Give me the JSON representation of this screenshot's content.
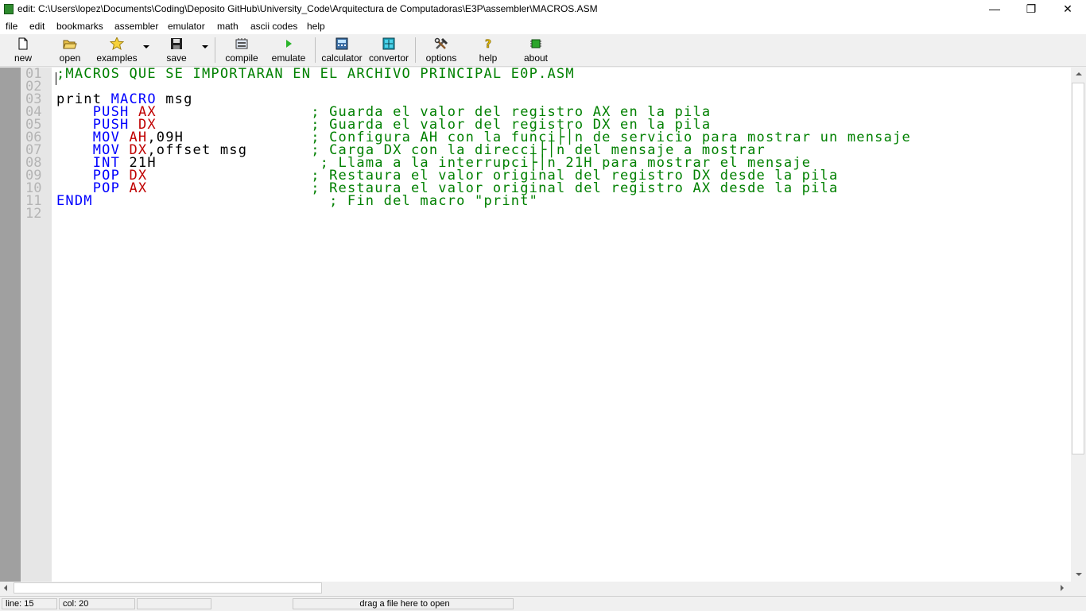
{
  "window": {
    "title": "edit: C:\\Users\\lopez\\Documents\\Coding\\Deposito GitHub\\University_Code\\Arquitectura de Computadoras\\E3P\\assembler\\MACROS.ASM",
    "minimize": "—",
    "restore": "❐",
    "close": "✕"
  },
  "menu": [
    "file",
    "edit",
    "bookmarks",
    "assembler",
    "emulator",
    "math",
    "ascii codes",
    "help"
  ],
  "toolbar": {
    "new": "new",
    "open": "open",
    "examples": "examples",
    "save": "save",
    "compile": "compile",
    "emulate": "emulate",
    "calculator": "calculator",
    "convertor": "convertor",
    "options": "options",
    "help": "help",
    "about": "about"
  },
  "line_numbers": [
    "01",
    "02",
    "03",
    "04",
    "05",
    "06",
    "07",
    "08",
    "09",
    "10",
    "11",
    "12"
  ],
  "code_lines": [
    [
      {
        "t": ";MACROS QUE SE IMPORTARAN EN EL ARCHIVO PRINCIPAL E0P.ASM",
        "c": "cmt"
      }
    ],
    [],
    [
      {
        "t": "print ",
        "c": "plain"
      },
      {
        "t": "MACRO",
        "c": "kw"
      },
      {
        "t": " msg",
        "c": "plain"
      }
    ],
    [
      {
        "t": "    ",
        "c": "plain"
      },
      {
        "t": "PUSH",
        "c": "kw"
      },
      {
        "t": " ",
        "c": "plain"
      },
      {
        "t": "AX",
        "c": "reg"
      },
      {
        "t": "                 ",
        "c": "plain"
      },
      {
        "t": "; Guarda el valor del registro AX en la pila",
        "c": "cmt"
      }
    ],
    [
      {
        "t": "    ",
        "c": "plain"
      },
      {
        "t": "PUSH",
        "c": "kw"
      },
      {
        "t": " ",
        "c": "plain"
      },
      {
        "t": "DX",
        "c": "reg"
      },
      {
        "t": "                 ",
        "c": "plain"
      },
      {
        "t": "; Guarda el valor del registro DX en la pila",
        "c": "cmt"
      }
    ],
    [
      {
        "t": "    ",
        "c": "plain"
      },
      {
        "t": "MOV",
        "c": "kw"
      },
      {
        "t": " ",
        "c": "plain"
      },
      {
        "t": "AH",
        "c": "reg"
      },
      {
        "t": ",09H",
        "c": "plain"
      },
      {
        "t": "              ",
        "c": "plain"
      },
      {
        "t": "; Configura AH con la funci├│n de servicio para mostrar un mensaje",
        "c": "cmt"
      }
    ],
    [
      {
        "t": "    ",
        "c": "plain"
      },
      {
        "t": "MOV",
        "c": "kw"
      },
      {
        "t": " ",
        "c": "plain"
      },
      {
        "t": "DX",
        "c": "reg"
      },
      {
        "t": ",offset msg",
        "c": "plain"
      },
      {
        "t": "       ",
        "c": "plain"
      },
      {
        "t": "; Carga DX con la direcci├│n del mensaje a mostrar",
        "c": "cmt"
      }
    ],
    [
      {
        "t": "    ",
        "c": "plain"
      },
      {
        "t": "INT",
        "c": "kw"
      },
      {
        "t": " 21H",
        "c": "plain"
      },
      {
        "t": "                  ",
        "c": "plain"
      },
      {
        "t": "; Llama a la interrupci├│n 21H para mostrar el mensaje",
        "c": "cmt"
      }
    ],
    [
      {
        "t": "    ",
        "c": "plain"
      },
      {
        "t": "POP",
        "c": "kw"
      },
      {
        "t": " ",
        "c": "plain"
      },
      {
        "t": "DX",
        "c": "reg"
      },
      {
        "t": "                  ",
        "c": "plain"
      },
      {
        "t": "; Restaura el valor original del registro DX desde la pila",
        "c": "cmt"
      }
    ],
    [
      {
        "t": "    ",
        "c": "plain"
      },
      {
        "t": "POP",
        "c": "kw"
      },
      {
        "t": " ",
        "c": "plain"
      },
      {
        "t": "AX",
        "c": "reg"
      },
      {
        "t": "                  ",
        "c": "plain"
      },
      {
        "t": "; Restaura el valor original del registro AX desde la pila",
        "c": "cmt"
      }
    ],
    [
      {
        "t": "ENDM",
        "c": "kw"
      },
      {
        "t": "                          ",
        "c": "plain"
      },
      {
        "t": "; Fin del macro \"print\"",
        "c": "cmt"
      }
    ],
    []
  ],
  "status": {
    "line": "line: 15",
    "col": "col: 20",
    "drop_hint": "drag a file here to open"
  },
  "colors": {
    "keyword": "#0000ff",
    "register": "#c00000",
    "comment": "#008000",
    "line_number": "#b4b4b4"
  }
}
